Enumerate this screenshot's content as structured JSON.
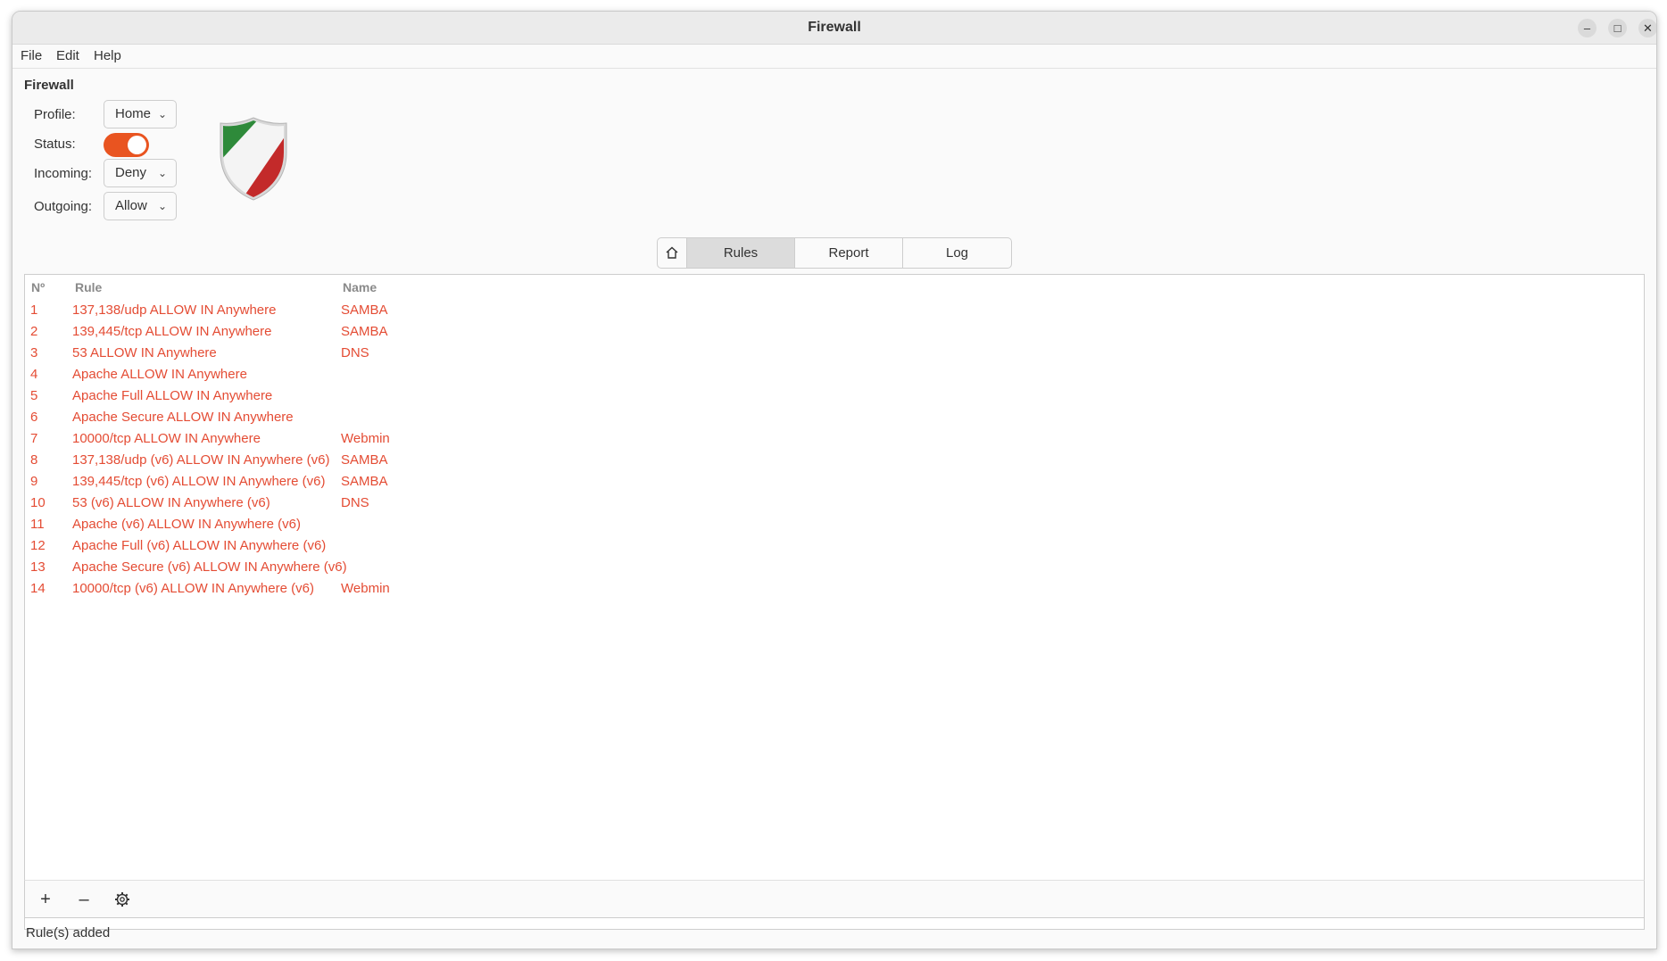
{
  "window": {
    "title": "Firewall",
    "controls": {
      "minimize": "–",
      "maximize": "□",
      "close": "✕"
    }
  },
  "menu": [
    "File",
    "Edit",
    "Help"
  ],
  "section_title": "Firewall",
  "settings": {
    "profile_label": "Profile:",
    "profile_value": "Home",
    "status_label": "Status:",
    "status_on": true,
    "incoming_label": "Incoming:",
    "incoming_value": "Deny",
    "outgoing_label": "Outgoing:",
    "outgoing_value": "Allow"
  },
  "tabs": {
    "home_icon": "home-icon",
    "items": [
      "Rules",
      "Report",
      "Log"
    ],
    "active": "Rules"
  },
  "table": {
    "columns": [
      "Nº",
      "Rule",
      "Name"
    ],
    "rows": [
      {
        "n": "1",
        "rule": "137,138/udp ALLOW IN Anywhere",
        "name": "SAMBA"
      },
      {
        "n": "2",
        "rule": "139,445/tcp ALLOW IN Anywhere",
        "name": "SAMBA"
      },
      {
        "n": "3",
        "rule": "53 ALLOW IN Anywhere",
        "name": "DNS"
      },
      {
        "n": "4",
        "rule": "Apache ALLOW IN Anywhere",
        "name": ""
      },
      {
        "n": "5",
        "rule": "Apache Full ALLOW IN Anywhere",
        "name": ""
      },
      {
        "n": "6",
        "rule": "Apache Secure ALLOW IN Anywhere",
        "name": ""
      },
      {
        "n": "7",
        "rule": "10000/tcp ALLOW IN Anywhere",
        "name": "Webmin"
      },
      {
        "n": "8",
        "rule": "137,138/udp (v6) ALLOW IN Anywhere (v6)",
        "name": "SAMBA"
      },
      {
        "n": "9",
        "rule": "139,445/tcp (v6) ALLOW IN Anywhere (v6)",
        "name": "SAMBA"
      },
      {
        "n": "10",
        "rule": "53 (v6) ALLOW IN Anywhere (v6)",
        "name": "DNS"
      },
      {
        "n": "11",
        "rule": "Apache (v6) ALLOW IN Anywhere (v6)",
        "name": ""
      },
      {
        "n": "12",
        "rule": "Apache Full (v6) ALLOW IN Anywhere (v6)",
        "name": ""
      },
      {
        "n": "13",
        "rule": "Apache Secure (v6) ALLOW IN Anywhere (v6)",
        "name": ""
      },
      {
        "n": "14",
        "rule": "10000/tcp (v6) ALLOW IN Anywhere (v6)",
        "name": "Webmin"
      }
    ]
  },
  "toolbar": {
    "add": "+",
    "remove": "–",
    "settings_icon": "gear-icon"
  },
  "status_message": "Rule(s) added",
  "colors": {
    "accent": "#e95420",
    "rule_text": "#e44c34"
  }
}
